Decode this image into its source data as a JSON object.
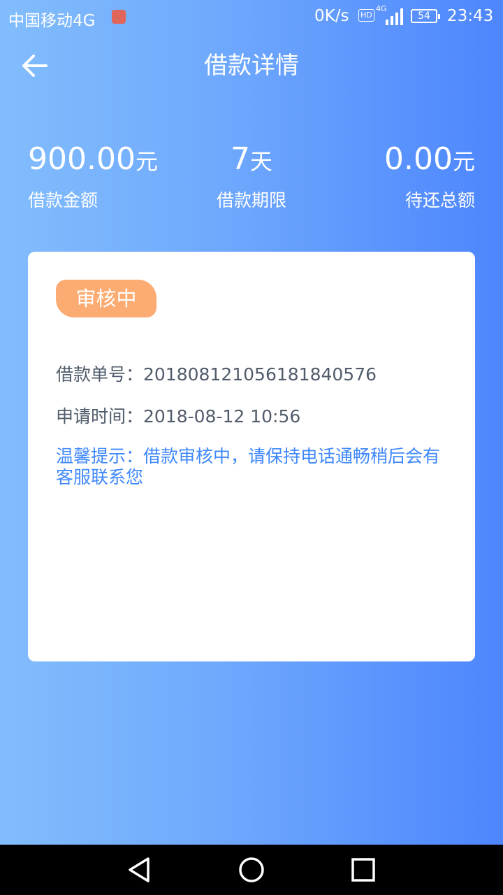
{
  "status_bar": {
    "carrier": "中国移动4G",
    "net_speed": "0K/s",
    "hd": "HD",
    "network": "4G",
    "battery": "54",
    "time": "23:43"
  },
  "header": {
    "title": "借款详情",
    "back_icon": "arrow-left-icon"
  },
  "summary": {
    "amount": {
      "value": "900.00",
      "unit": "元",
      "label": "借款金额"
    },
    "term": {
      "value": "7",
      "unit": "天",
      "label": "借款期限"
    },
    "outstanding": {
      "value": "0.00",
      "unit": "元",
      "label": "待还总额"
    }
  },
  "card": {
    "status": "审核中",
    "order_no": "借款单号：20180812105618184057​6",
    "apply_time": "申请时间：2018-08-12 10:56",
    "tip": "温馨提示：借款审核中，请保持电话通畅稍后会有客服联系您"
  },
  "nav": {
    "back": "triangle-back-icon",
    "home": "circle-home-icon",
    "recent": "square-recent-icon"
  },
  "colors": {
    "gradient_left": "#82bdfd",
    "gradient_right": "#4d86fd",
    "status_tag": "#fcab72",
    "tip_text": "#3f88fb"
  }
}
